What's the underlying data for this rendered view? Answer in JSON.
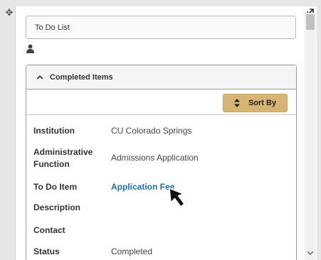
{
  "panel": {
    "title": "To Do List"
  },
  "section": {
    "header": "Completed Items",
    "sort_label": "Sort By"
  },
  "details": [
    {
      "label": "Institution",
      "value": "CU Colorado Springs"
    },
    {
      "label": "Administrative Function",
      "value": "Admissions Application"
    },
    {
      "label": "To Do Item",
      "value": "Application Fee"
    },
    {
      "label": "Description",
      "value": ""
    },
    {
      "label": "Contact",
      "value": ""
    },
    {
      "label": "Status",
      "value": "Completed"
    }
  ],
  "colors": {
    "accent_button": "#d6b574",
    "link": "#1f6fb8"
  },
  "icons": {
    "drag": "move-icon",
    "expand": "expand-icon",
    "user": "user-icon",
    "collapse": "chevron-up-icon",
    "sort": "sort-icon",
    "pointer": "mouse-pointer-icon"
  }
}
